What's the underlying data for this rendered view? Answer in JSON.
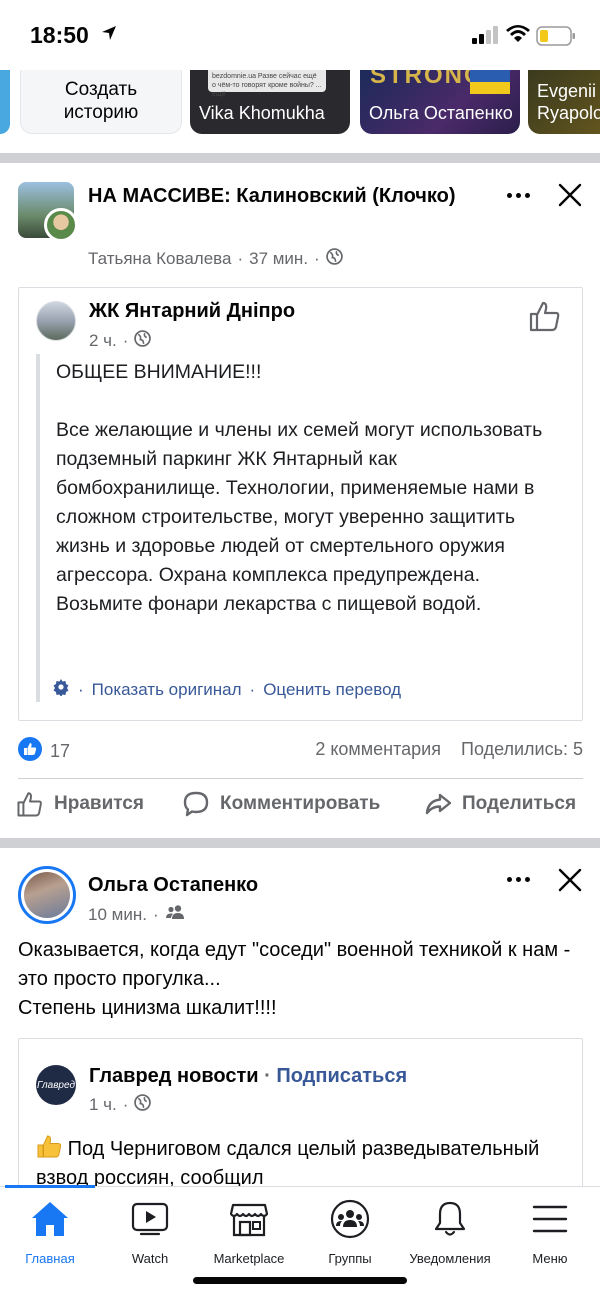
{
  "status_bar": {
    "time": "18:50"
  },
  "stories": {
    "create_label_1": "Создать",
    "create_label_2": "историю",
    "items": [
      {
        "name": "Vika Khomukha",
        "thumb_text": "bezdomnie.ua Разве сейчас ещё о чём-то говорят кроме войны? ... ещё"
      },
      {
        "name": "Ольга Остапенко",
        "banner_text": "STRONG"
      },
      {
        "name": "Evgenii Ryapolo"
      }
    ]
  },
  "post1": {
    "title": "НА МАССИВЕ: Калиновский (Клочко)",
    "author": "Татьяна Ковалева",
    "time": "37 мин.",
    "shared": {
      "page_name": "ЖК Янтарний Дніпро",
      "time": "2 ч.",
      "text_heading": "ОБЩЕЕ ВНИМАНИЕ!!!",
      "text_body": "Все желающие и члены их семей могут использовать подземный паркинг ЖК Янтарный как бомбохранилище. Технологии, применяемые нами в сложном строительстве, могут уверенно защитить жизнь и здоровье людей от смертельного оружия агрессора. Охрана комплекса предупреждена. Возьмите фонари лекарства с пищевой водой.",
      "show_original": "Показать оригинал",
      "rate_translation": "Оценить перевод"
    },
    "likes": "17",
    "comments": "2 комментария",
    "shares": "Поделились: 5"
  },
  "actions": {
    "like": "Нравится",
    "comment": "Комментировать",
    "share": "Поделиться"
  },
  "post2": {
    "author": "Ольга Остапенко",
    "time": "10 мин.",
    "text_line1": "Оказывается, когда едут \"соседи\" военной техникой к нам - это просто прогулка...",
    "text_line2": "Степень цинизма шкалит!!!!",
    "shared": {
      "avatar_text": "Главред",
      "page_name": "Главред новости",
      "subscribe": "Подписаться",
      "time": "1 ч.",
      "text": "Под Черниговом сдался целый разведывательный взвод россиян, сообщил"
    }
  },
  "tabbar": {
    "items": [
      {
        "label": "Главная",
        "icon": "home-icon",
        "active": true
      },
      {
        "label": "Watch",
        "icon": "watch-icon"
      },
      {
        "label": "Marketplace",
        "icon": "marketplace-icon"
      },
      {
        "label": "Группы",
        "icon": "groups-icon"
      },
      {
        "label": "Уведомления",
        "icon": "bell-icon"
      },
      {
        "label": "Меню",
        "icon": "menu-icon"
      }
    ]
  },
  "colors": {
    "accent": "#1877f2",
    "link": "#385898",
    "secondary_text": "#65676b",
    "divider": "#ced0d4"
  }
}
